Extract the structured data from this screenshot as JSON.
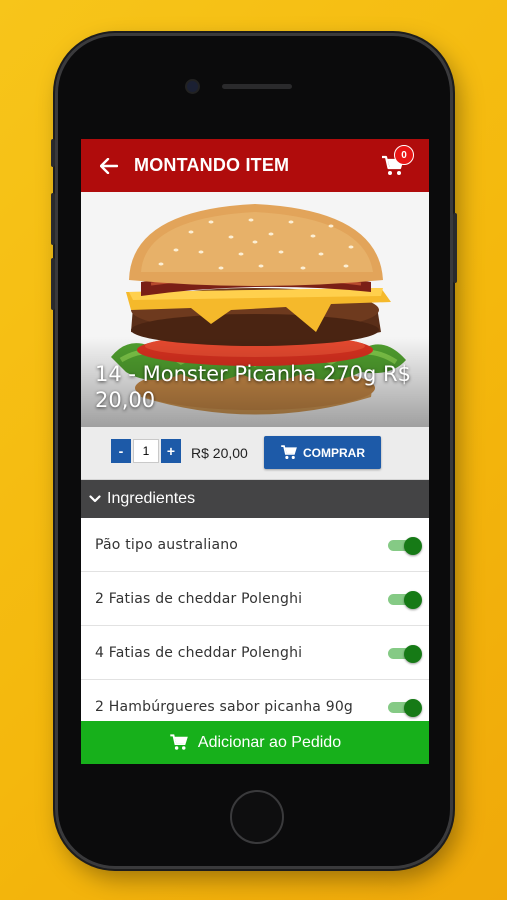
{
  "header": {
    "title": "MONTANDO ITEM",
    "cart_count": "0"
  },
  "product": {
    "title": "14 - Monster Picanha 270g R$ 20,00"
  },
  "purchase": {
    "minus_label": "-",
    "quantity": "1",
    "plus_label": "+",
    "price": "R$ 20,00",
    "buy_label": "COMPRAR"
  },
  "ingredients": {
    "section_label": "Ingredientes",
    "items": [
      {
        "label": "Pão tipo australiano",
        "enabled": true
      },
      {
        "label": "2 Fatias de cheddar Polenghi",
        "enabled": true
      },
      {
        "label": "4 Fatias de cheddar Polenghi",
        "enabled": true
      },
      {
        "label": "2 Hambúrgueres sabor picanha 90g",
        "enabled": true
      }
    ]
  },
  "footer": {
    "add_label": "Adicionar ao Pedido"
  },
  "colors": {
    "appbar": "#b00c0c",
    "primary_button": "#1d5aa8",
    "add_button": "#17b01b",
    "section_header": "#444445",
    "toggle_on": "#167a16"
  }
}
